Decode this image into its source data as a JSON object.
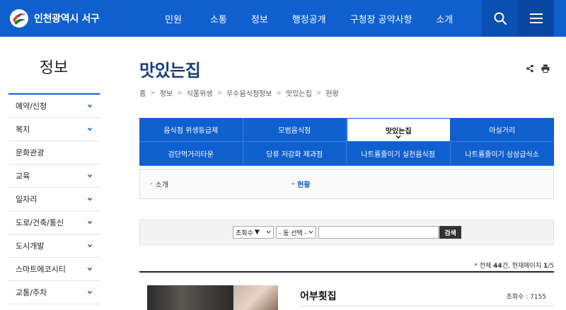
{
  "header": {
    "logo_text": "인천광역시 서구",
    "nav": [
      "민원",
      "소통",
      "정보",
      "행정공개",
      "구청장 공약사항",
      "소개"
    ],
    "search_icon": "search-icon",
    "menu_icon": "hamburger-menu-icon"
  },
  "sidebar": {
    "title": "정보",
    "items": [
      {
        "label": "예약/신청",
        "has_submenu": true
      },
      {
        "label": "복지",
        "has_submenu": true
      },
      {
        "label": "문화관광",
        "has_submenu": false
      },
      {
        "label": "교육",
        "has_submenu": true
      },
      {
        "label": "일자리",
        "has_submenu": true
      },
      {
        "label": "도로/건축/통신",
        "has_submenu": true
      },
      {
        "label": "도시개발",
        "has_submenu": true
      },
      {
        "label": "스마트에코시티",
        "has_submenu": true
      },
      {
        "label": "교통/주차",
        "has_submenu": true
      }
    ]
  },
  "main": {
    "title": "맛있는집",
    "breadcrumb": [
      "홈",
      "정보",
      "식품위생",
      "우수음식점정보",
      "맛있는집",
      "현황"
    ],
    "tabs": [
      {
        "label": "음식점 위생등급제",
        "active": false
      },
      {
        "label": "모범음식점",
        "active": false
      },
      {
        "label": "맛있는집",
        "active": true
      },
      {
        "label": "마실거리",
        "active": false
      },
      {
        "label": "검단먹거리타운",
        "active": false
      },
      {
        "label": "당류 저감화 제과점",
        "active": false
      },
      {
        "label": "나트륨줄이기 실천음식점",
        "active": false
      },
      {
        "label": "나트륨줄이기 삼삼급식소",
        "active": false
      }
    ],
    "subtabs": [
      {
        "label": "소개",
        "active": false
      },
      {
        "label": "현황",
        "active": true
      }
    ],
    "filter": {
      "sort_select": "조회수",
      "dong_select": "- 동 선택 -",
      "search_placeholder": "",
      "search_button": "검색"
    },
    "count": {
      "prefix": "* 전체 ",
      "total": "44",
      "mid": "건, 현재페이지 ",
      "page": "1",
      "suffix": "/5"
    },
    "list": [
      {
        "name": "어부횟집",
        "views_label": "조회수 : 7155"
      }
    ]
  },
  "colors": {
    "primary": "#0f5fcf",
    "title": "#1a3c7a"
  }
}
